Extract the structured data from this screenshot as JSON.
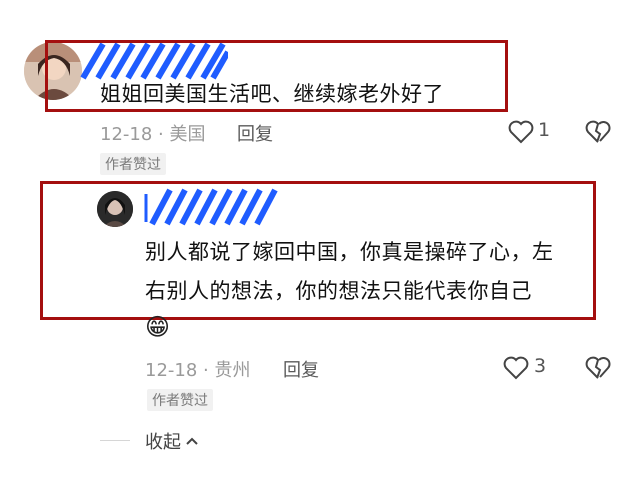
{
  "comment1": {
    "text": "姐姐回美国生活吧、继续嫁老外好了",
    "date_loc": "12-18 · 美国",
    "reply_label": "回复",
    "like_count": "1",
    "badge": "作者赞过"
  },
  "reply1": {
    "line1": "别人都说了嫁回中国，你真是操碎了心，左",
    "line2": "右别人的想法，你的想法只能代表你自己",
    "emoji": "😁",
    "date_loc": "12-18 · 贵州",
    "reply_label": "回复",
    "like_count": "3",
    "badge": "作者赞过"
  },
  "collapse": {
    "label": "收起"
  },
  "colors": {
    "highlight_box": "#a40f0f",
    "redact_blue": "#1f5cff"
  }
}
